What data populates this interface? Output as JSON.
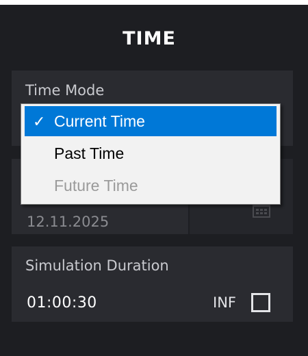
{
  "panel": {
    "title": "TIME"
  },
  "time_mode": {
    "label": "Time Mode",
    "selected": "Current Time",
    "options": [
      {
        "label": "Current Time",
        "selected": true,
        "enabled": true
      },
      {
        "label": "Past Time",
        "selected": false,
        "enabled": true
      },
      {
        "label": "Future Time",
        "selected": false,
        "enabled": false
      }
    ],
    "check_glyph": "✓"
  },
  "date": {
    "value": "12.11.2025",
    "icon": "calendar-icon"
  },
  "simulation": {
    "label": "Simulation Duration",
    "duration": "01:00:30",
    "inf_label": "INF",
    "inf_checked": false
  },
  "colors": {
    "panel_bg": "#1d1e22",
    "card_bg": "#2a2b30",
    "selection": "#0078d7",
    "dropdown_bg": "#f2f2f2"
  }
}
